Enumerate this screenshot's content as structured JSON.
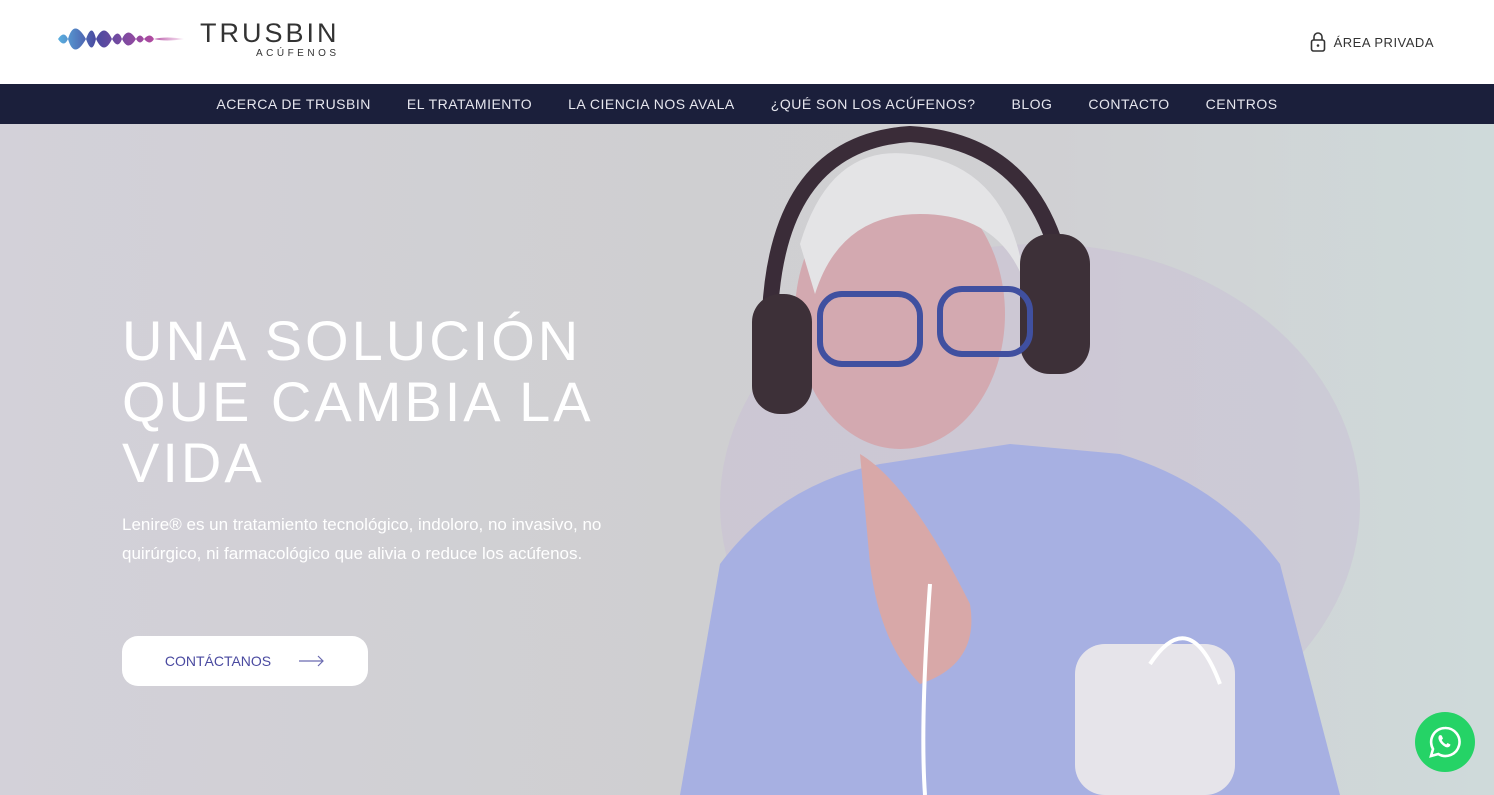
{
  "header": {
    "brand": "TRUSBIN",
    "brand_sub": "ACÚFENOS",
    "private_area": "ÁREA PRIVADA"
  },
  "nav": [
    "ACERCA DE TRUSBIN",
    "EL TRATAMIENTO",
    "LA CIENCIA NOS AVALA",
    "¿QUÉ SON LOS ACÚFENOS?",
    "BLOG",
    "CONTACTO",
    "CENTROS"
  ],
  "hero": {
    "title": "UNA SOLUCIÓN QUE CAMBIA LA VIDA",
    "description": "Lenire® es un tratamiento tecnológico, indoloro, no invasivo, no quirúrgico, ni farmacológico que alivia o reduce los acúfenos.",
    "cta": "CONTÁCTANOS"
  },
  "colors": {
    "nav_bg": "#1b1f3b",
    "whatsapp": "#25d366",
    "cta_text": "#4a4aa0"
  }
}
